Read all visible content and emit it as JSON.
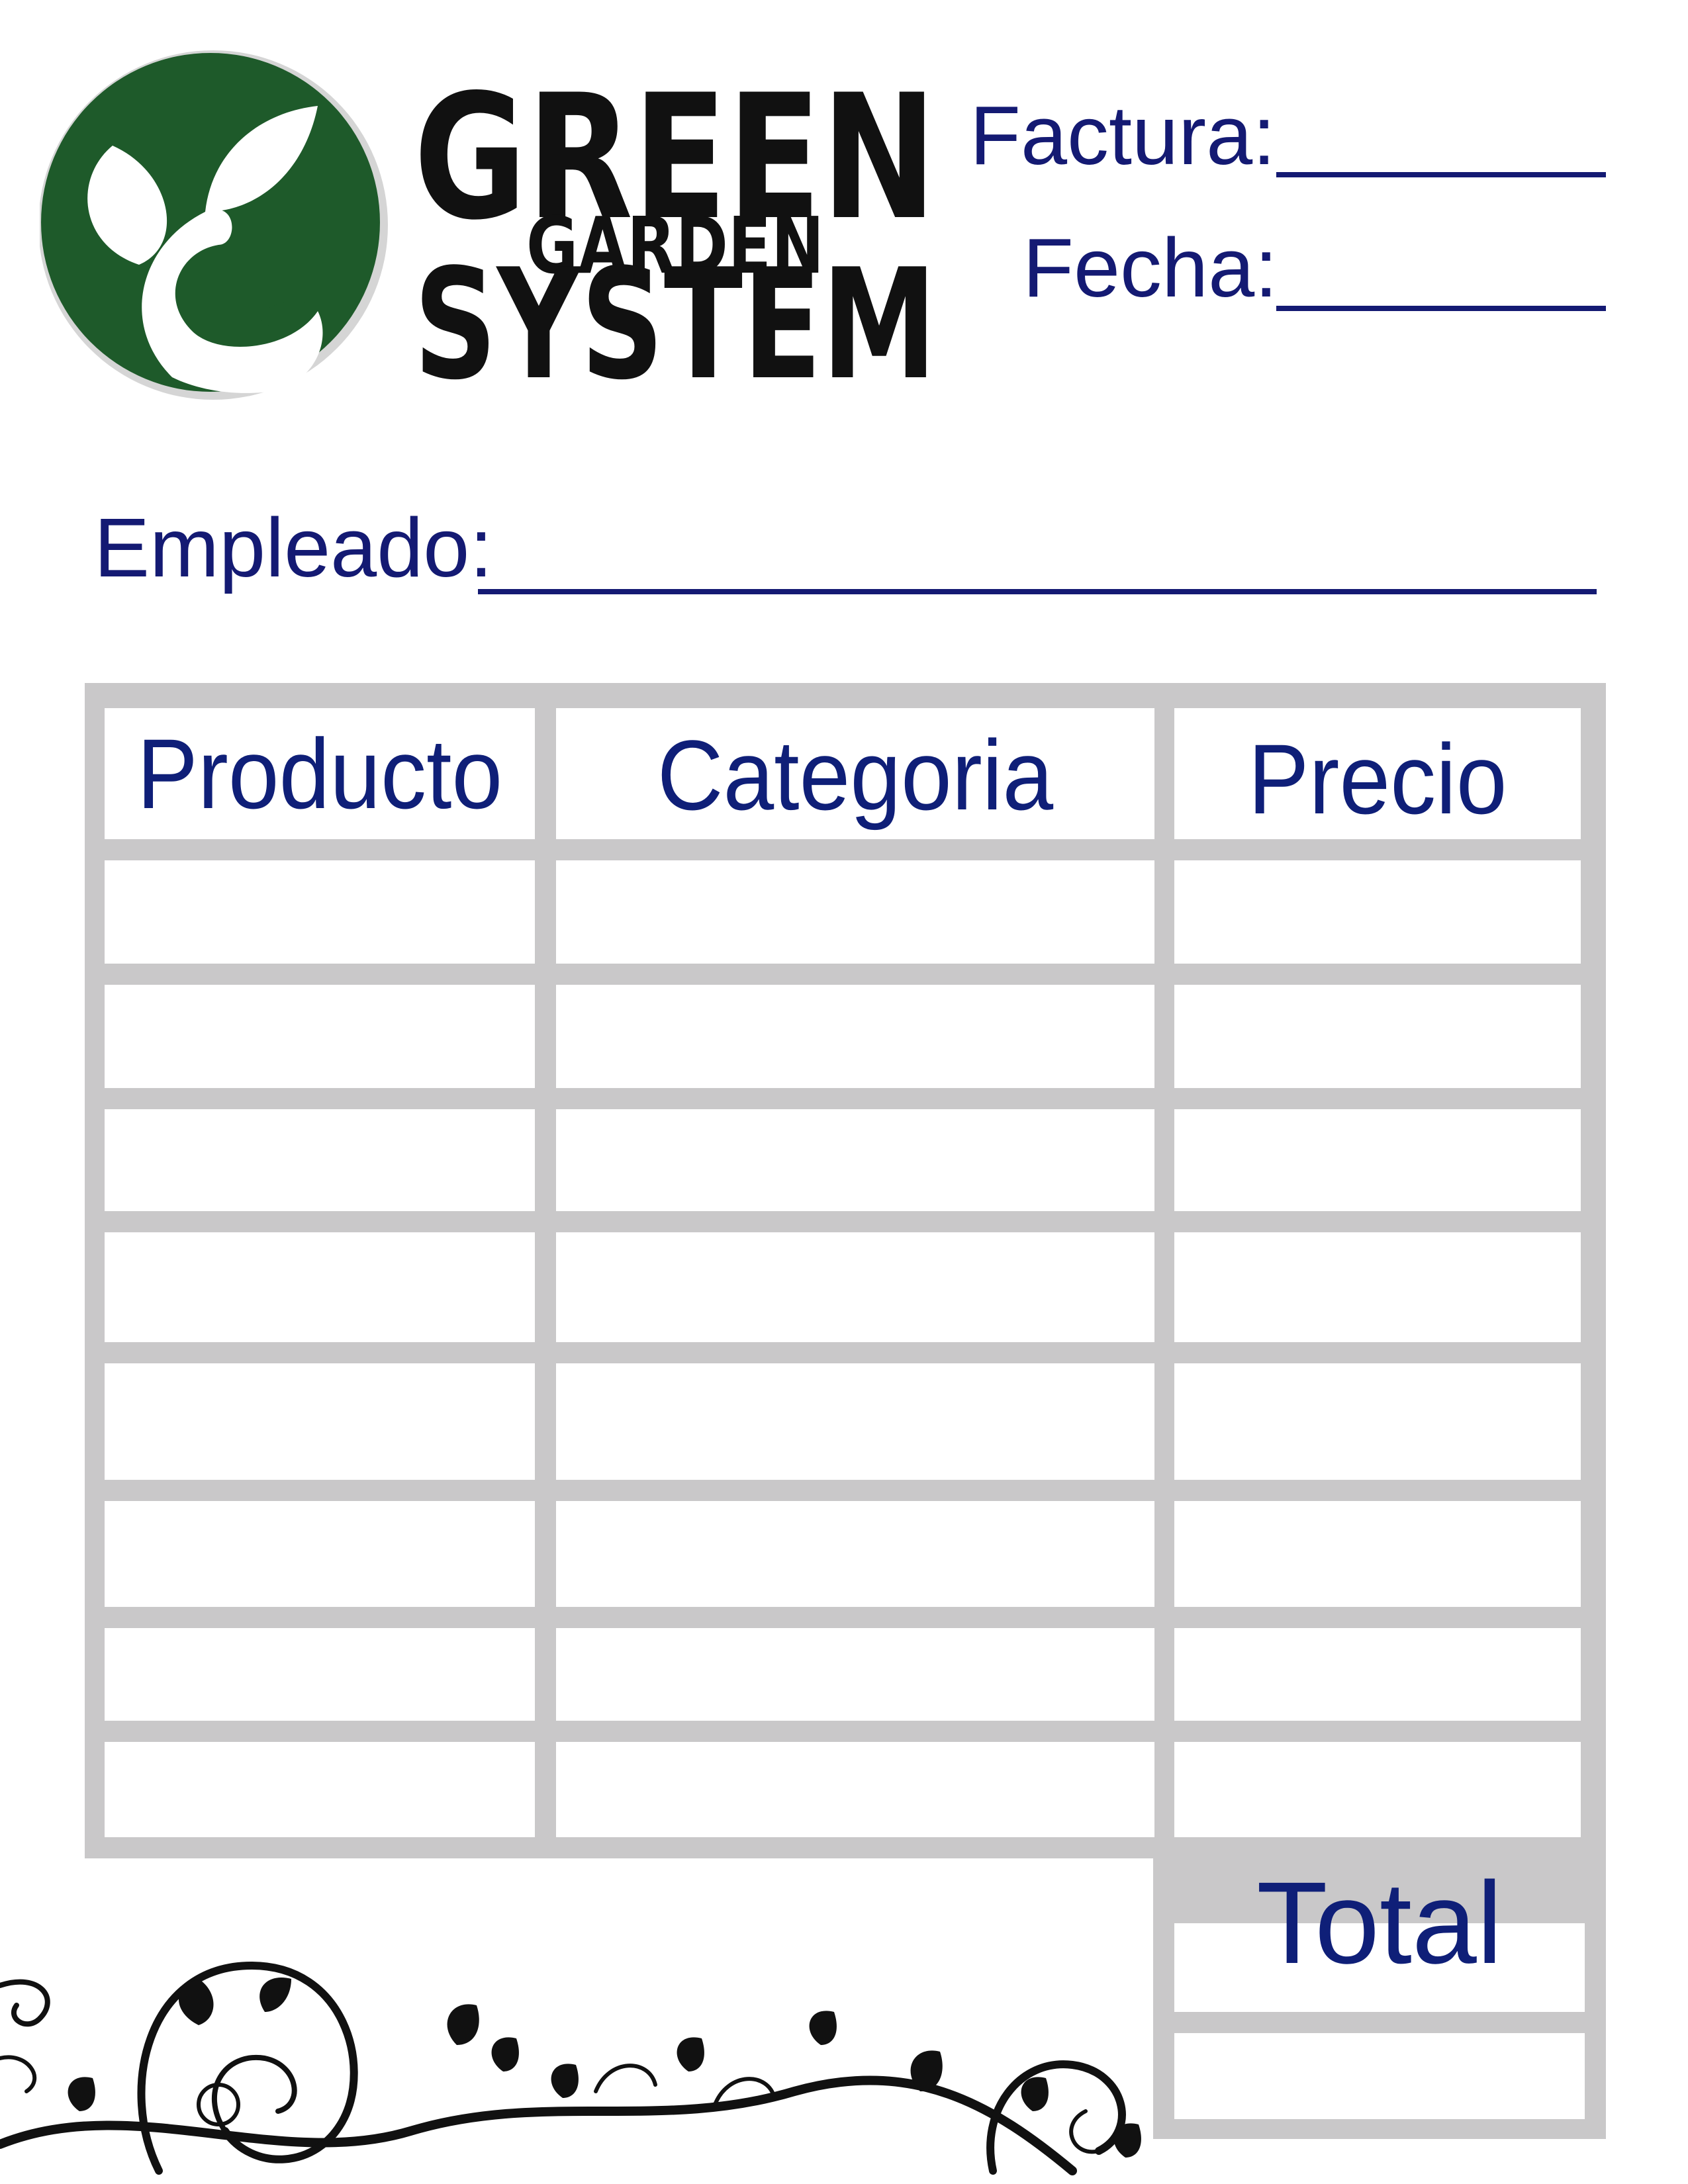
{
  "brand": {
    "word_top": "GREEN",
    "word_middle": "GARDEN",
    "word_bottom": "SYSTEM",
    "circle_color": "#1e5a2a"
  },
  "header": {
    "invoice_label": "Factura:",
    "date_label": "Fecha:",
    "employee_label": "Empleado:"
  },
  "table": {
    "columns": [
      "Producto",
      "Categoria",
      "Precio"
    ],
    "empty_rows": 8,
    "border_color": "#c9c8c9"
  },
  "total": {
    "label": "Total"
  },
  "colors": {
    "text": "#141a73",
    "table_grey": "#c9c8c9"
  }
}
